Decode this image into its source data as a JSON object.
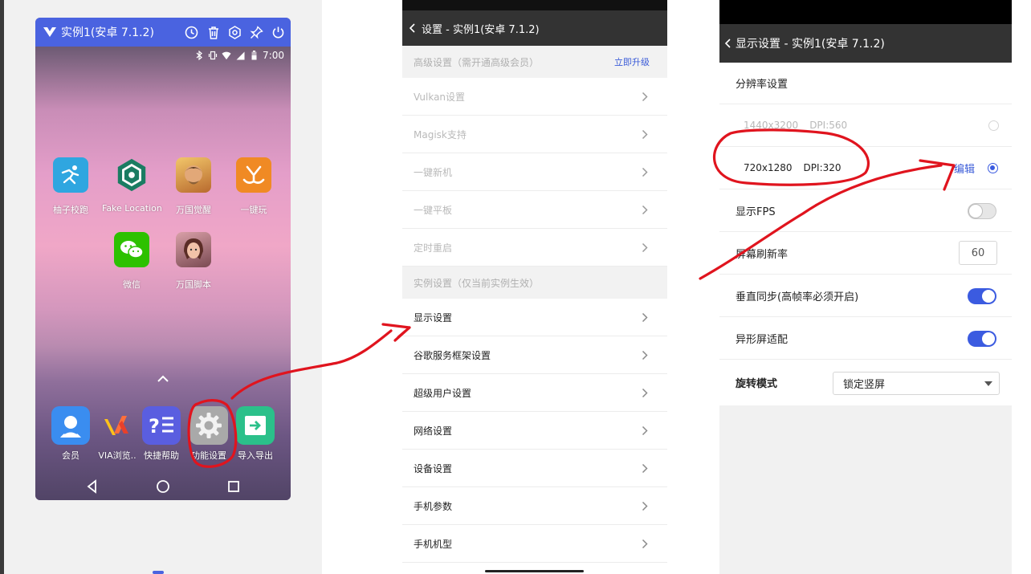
{
  "colors": {
    "accent": "#4a63e0",
    "link": "#3a5bd8",
    "annotation": "#e0141e",
    "dark_header": "#333333"
  },
  "emulator": {
    "title": "实例1(安卓 7.1.2)",
    "toolbar_icons": [
      "clock-icon",
      "trash-icon",
      "settings-icon",
      "pin-icon",
      "power-icon"
    ],
    "status_bar": {
      "time": "7:00",
      "icons": [
        "bluetooth-icon",
        "vibrate-icon",
        "wifi-icon",
        "signal-icon",
        "battery-icon"
      ]
    },
    "apps": [
      {
        "label": "柚子校跑",
        "icon": "runner-icon",
        "color": "#2fa6e0"
      },
      {
        "label": "Fake Location",
        "icon": "location-icon",
        "color": "#1a7c62"
      },
      {
        "label": "万国觉醒",
        "icon": "game-avatar-icon",
        "color": "#d79a3a"
      },
      {
        "label": "一键玩",
        "icon": "y-logo-icon",
        "color": "#f08a24"
      },
      {
        "label": "微信",
        "icon": "wechat-icon",
        "color": "#2dc100"
      },
      {
        "label": "万国脚本",
        "icon": "script-avatar-icon",
        "color": "#b7665f"
      }
    ],
    "dock": [
      {
        "label": "会员",
        "icon": "member-icon",
        "color": "#3a8df0"
      },
      {
        "label": "VIA浏览..",
        "icon": "via-browser-icon",
        "color": "#ff6f3a"
      },
      {
        "label": "快捷帮助",
        "icon": "help-icon",
        "color": "#5a5ee0"
      },
      {
        "label": "功能设置",
        "icon": "gear-icon",
        "color": "#9a9a9a"
      },
      {
        "label": "导入导出",
        "icon": "import-export-icon",
        "color": "#2bc08a"
      }
    ],
    "nav": [
      "back-icon",
      "home-icon",
      "recents-icon"
    ]
  },
  "settings": {
    "title": "设置 - 实例1(安卓 7.1.2)",
    "section_advanced": "高级设置（需开通高级会员）",
    "upgrade_link": "立即升级",
    "section_instance": "实例设置（仅当前实例生效）",
    "items": [
      {
        "label": "Vulkan设置",
        "disabled": true
      },
      {
        "label": "Magisk支持",
        "disabled": true
      },
      {
        "label": "一键新机",
        "disabled": true
      },
      {
        "label": "一键平板",
        "disabled": true
      },
      {
        "label": "定时重启",
        "disabled": true
      },
      {
        "label": "显示设置",
        "disabled": false
      },
      {
        "label": "谷歌服务框架设置",
        "disabled": false
      },
      {
        "label": "超级用户设置",
        "disabled": false
      },
      {
        "label": "网络设置",
        "disabled": false
      },
      {
        "label": "设备设置",
        "disabled": false
      },
      {
        "label": "手机参数",
        "disabled": false
      },
      {
        "label": "手机机型",
        "disabled": false
      }
    ]
  },
  "display": {
    "title": "显示设置 - 实例1(安卓 7.1.2)",
    "resolution_header": "分辨率设置",
    "resolutions": [
      {
        "size": "1440x3200",
        "dpi": "DPI:560",
        "selected": false,
        "editable": false
      },
      {
        "size": "720x1280",
        "dpi": "DPI:320",
        "selected": true,
        "editable": true
      }
    ],
    "edit_label": "编辑",
    "toggles": [
      {
        "label": "显示FPS",
        "on": false
      },
      {
        "label": "垂直同步(高帧率必须开启)",
        "on": true
      },
      {
        "label": "异形屏适配",
        "on": true
      }
    ],
    "refresh_label": "屏幕刷新率",
    "refresh_value": "60",
    "rotation_label": "旋转模式",
    "rotation_value": "锁定竖屏"
  }
}
